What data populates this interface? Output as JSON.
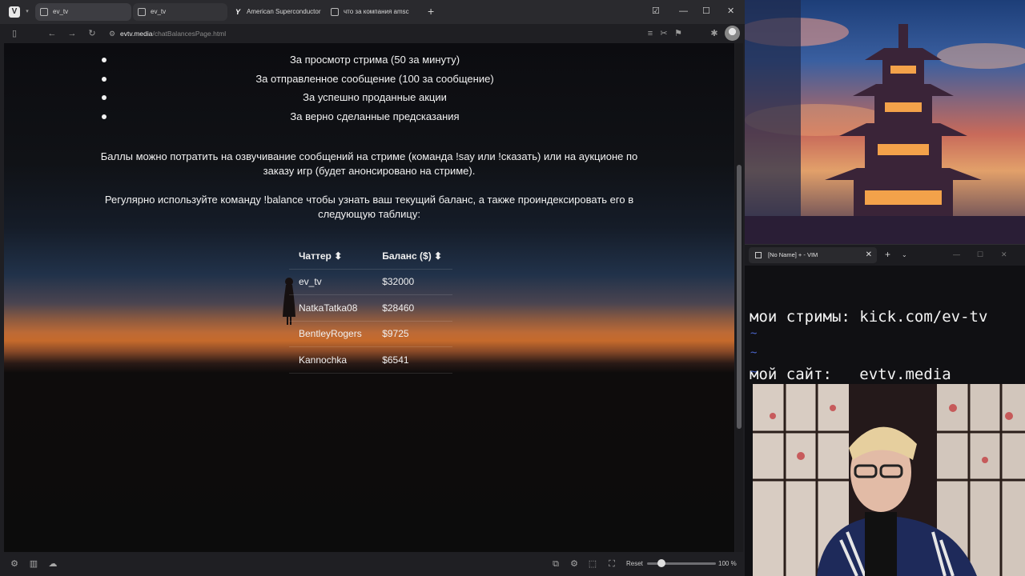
{
  "browser": {
    "tabs": [
      {
        "label": "ev_tv",
        "state": "active"
      },
      {
        "label": "ev_tv",
        "state": "dim"
      },
      {
        "label": "American Superconductor",
        "state": "normal"
      },
      {
        "label": "что за компания amsc",
        "state": "normal"
      }
    ],
    "new_tab_label": "+",
    "address_domain": "evtv.media",
    "address_path": "/chatBalancesPage.html"
  },
  "page": {
    "earn_methods": [
      "За просмотр стрима (50 за минуту)",
      "За отправленное сообщение (100 за сообщение)",
      "За успешно проданные акции",
      "За верно сделанные предсказания"
    ],
    "spend_paragraph": "Баллы можно потратить на озвучивание сообщений на стриме (команда !say или !сказать) или на аукционе по заказу игр (будет анонсировано на стриме).",
    "balance_paragraph": "Регулярно используйте команду !balance чтобы узнать ваш текущий баланс, а также проиндексировать его в следующую таблицу:",
    "table": {
      "headers": [
        "Чаттер ⬍",
        "Баланс ($) ⬍"
      ],
      "rows": [
        {
          "chatter": "ev_tv",
          "balance": "$32000"
        },
        {
          "chatter": "NatkaTatka08",
          "balance": "$28460"
        },
        {
          "chatter": "BentleyRogers",
          "balance": "$9725"
        },
        {
          "chatter": "Kannochka",
          "balance": "$6541"
        }
      ]
    }
  },
  "statusbar": {
    "reset_label": "Reset",
    "zoom": "100 %"
  },
  "vim": {
    "tab_title": "[No Name] + - VIM",
    "line1": "мои стримы: kick.com/ev-tv",
    "line2": "мой сайт:   evtv.media",
    "tilde": "~"
  },
  "colors": {
    "vim_tilde": "#4a64c8",
    "page_text": "#f2f2f2"
  }
}
